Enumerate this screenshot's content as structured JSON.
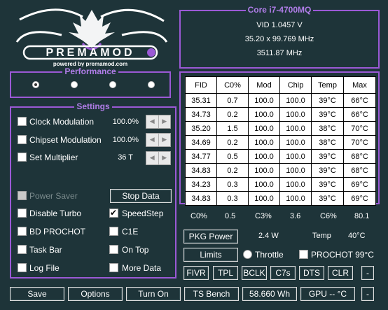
{
  "logo": {
    "brand": "PREMAMOD",
    "tagline": "powered by premamod.com"
  },
  "cpu": {
    "name": "Core i7-4700MQ",
    "vid": "VID  1.0457 V",
    "clock": "35.20 x 99.769 MHz",
    "freq": "3511.87 MHz"
  },
  "performance": {
    "title": "Performance",
    "selected_index": 0
  },
  "settings": {
    "title": "Settings",
    "clock_mod": {
      "label": "Clock Modulation",
      "value": "100.0%"
    },
    "chipset_mod": {
      "label": "Chipset Modulation",
      "value": "100.0%"
    },
    "multiplier": {
      "label": "Set Multiplier",
      "value": "36 T"
    },
    "power_saver": {
      "label": "Power Saver"
    },
    "stop_data": "Stop Data",
    "disable_turbo": {
      "label": "Disable Turbo",
      "checked": false
    },
    "speedstep": {
      "label": "SpeedStep",
      "checked": true
    },
    "bd_prochot": {
      "label": "BD PROCHOT",
      "checked": false
    },
    "c1e": {
      "label": "C1E",
      "checked": false
    },
    "task_bar": {
      "label": "Task Bar",
      "checked": false
    },
    "on_top": {
      "label": "On Top",
      "checked": false
    },
    "log_file": {
      "label": "Log File",
      "checked": false
    },
    "more_data": {
      "label": "More Data",
      "checked": false
    }
  },
  "table": {
    "headers": [
      "FID",
      "C0%",
      "Mod",
      "Chip",
      "Temp",
      "Max"
    ],
    "rows": [
      [
        "35.31",
        "0.7",
        "100.0",
        "100.0",
        "39°C",
        "66°C"
      ],
      [
        "34.73",
        "0.2",
        "100.0",
        "100.0",
        "39°C",
        "66°C"
      ],
      [
        "35.20",
        "1.5",
        "100.0",
        "100.0",
        "38°C",
        "70°C"
      ],
      [
        "34.69",
        "0.2",
        "100.0",
        "100.0",
        "38°C",
        "70°C"
      ],
      [
        "34.77",
        "0.5",
        "100.0",
        "100.0",
        "39°C",
        "68°C"
      ],
      [
        "34.83",
        "0.2",
        "100.0",
        "100.0",
        "39°C",
        "68°C"
      ],
      [
        "34.23",
        "0.3",
        "100.0",
        "100.0",
        "39°C",
        "69°C"
      ],
      [
        "34.83",
        "0.3",
        "100.0",
        "100.0",
        "39°C",
        "69°C"
      ]
    ]
  },
  "cstates": {
    "c0_label": "C0%",
    "c0_value": "0.5",
    "c3_label": "C3%",
    "c3_value": "3.6",
    "c6_label": "C6%",
    "c6_value": "80.1"
  },
  "power": {
    "pkg_button": "PKG Power",
    "pkg_value": "2.4 W",
    "temp_label": "Temp",
    "temp_value": "40°C",
    "limits_button": "Limits",
    "throttle_label": "Throttle",
    "prochot_label": "PROCHOT 99°C"
  },
  "tools": [
    "FIVR",
    "TPL",
    "BCLK",
    "C7s",
    "DTS",
    "CLR"
  ],
  "tools_extra": "-",
  "bottom": {
    "save": "Save",
    "options": "Options",
    "turn_on": "Turn On",
    "ts_bench": "TS Bench",
    "energy": "58.660 Wh",
    "gpu": "GPU -- °C",
    "minimize": "-"
  },
  "colors": {
    "background": "#1e3439",
    "accent": "#9b59d6"
  }
}
